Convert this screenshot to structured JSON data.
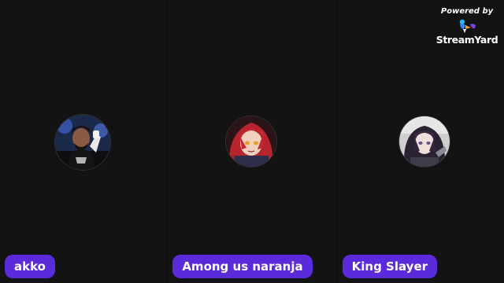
{
  "branding": {
    "powered_by": "Powered by",
    "name": "StreamYard",
    "icon": "streamyard-bird-icon"
  },
  "participants": [
    {
      "name": "akko",
      "avatar": "avatar-wrestler-photo"
    },
    {
      "name": "Among us naranja",
      "avatar": "avatar-anime-redhead"
    },
    {
      "name": "King Slayer",
      "avatar": "avatar-anime-darkhair"
    }
  ],
  "colors": {
    "background": "#121212",
    "nametag": "#5a2bdb",
    "text": "#ffffff"
  }
}
